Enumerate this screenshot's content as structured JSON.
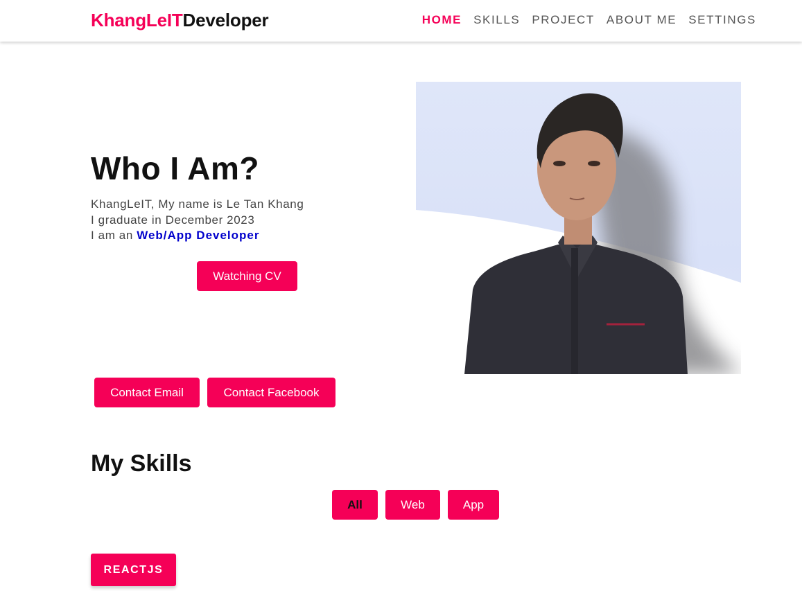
{
  "brand": {
    "part1": "KhangLeIT",
    "part2": "Developer"
  },
  "nav": {
    "items": [
      {
        "label": "HOME",
        "active": true
      },
      {
        "label": "SKILLS",
        "active": false
      },
      {
        "label": "PROJECT",
        "active": false
      },
      {
        "label": "ABOUT ME",
        "active": false
      },
      {
        "label": "SETTINGS",
        "active": false
      }
    ]
  },
  "hero": {
    "title": "Who I Am?",
    "line1": "KhangLeIT, My name is Le Tan Khang",
    "line2": "I graduate in December 2023",
    "line3_prefix": "I am an ",
    "line3_role": "Web/App Developer",
    "cv_button": "Watching CV",
    "contact_email": "Contact Email",
    "contact_facebook": "Contact Facebook"
  },
  "skills": {
    "title": "My Skills",
    "filters": [
      "All",
      "Web",
      "App"
    ],
    "items": [
      "REACTJS"
    ]
  },
  "colors": {
    "accent": "#f50057",
    "role": "#0000cc",
    "text": "#111111"
  }
}
